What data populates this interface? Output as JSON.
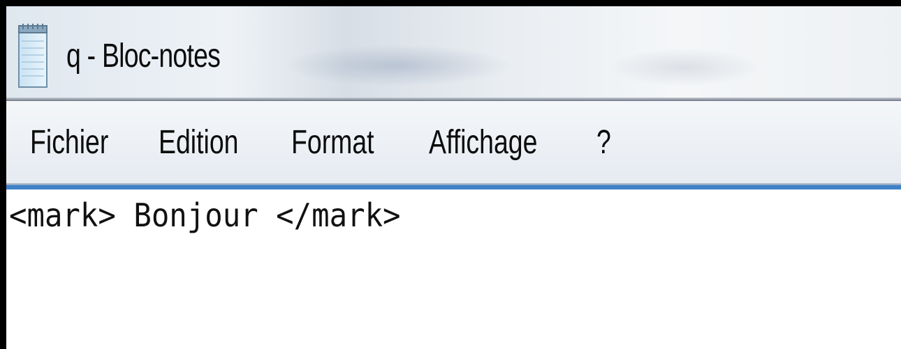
{
  "window": {
    "title": "q - Bloc-notes"
  },
  "menu": {
    "items": [
      {
        "label": "Fichier"
      },
      {
        "label": "Edition"
      },
      {
        "label": "Format"
      },
      {
        "label": "Affichage"
      },
      {
        "label": "?"
      }
    ]
  },
  "editor": {
    "content": "<mark> Bonjour </mark>"
  },
  "icons": {
    "app": "notepad-icon"
  },
  "colors": {
    "accent_line": "#3f82c9",
    "titlebar": "#e9edf1",
    "menubar": "#eef1f5",
    "frame": "#000000"
  }
}
